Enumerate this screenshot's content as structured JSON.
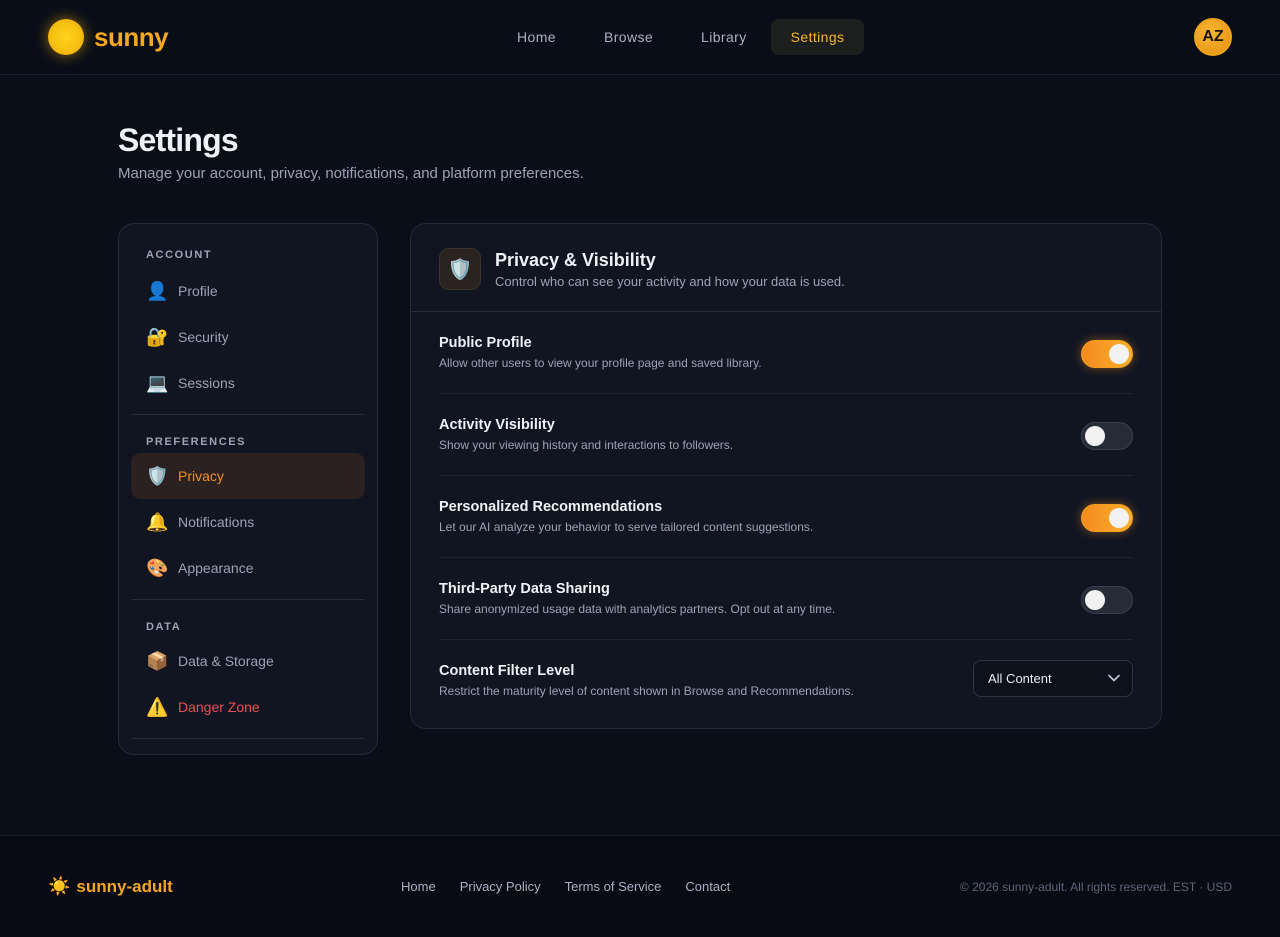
{
  "brand": {
    "name": "sunny"
  },
  "nav": {
    "items": [
      {
        "label": "Home"
      },
      {
        "label": "Browse"
      },
      {
        "label": "Library"
      },
      {
        "label": "Settings"
      }
    ],
    "active": "Settings"
  },
  "user": {
    "initials": "AZ"
  },
  "page": {
    "title": "Settings",
    "subtitle": "Manage your account, privacy, notifications, and platform preferences."
  },
  "sidebar": {
    "groups": [
      {
        "label": "ACCOUNT",
        "items": [
          {
            "label": "Profile",
            "icon": "👤",
            "icon_name": "user-icon"
          },
          {
            "label": "Security",
            "icon": "🔐",
            "icon_name": "lock-icon"
          },
          {
            "label": "Sessions",
            "icon": "💻",
            "icon_name": "laptop-icon"
          }
        ]
      },
      {
        "label": "PREFERENCES",
        "items": [
          {
            "label": "Privacy",
            "icon": "🛡️",
            "icon_name": "shield-icon",
            "active": true
          },
          {
            "label": "Notifications",
            "icon": "🔔",
            "icon_name": "bell-icon"
          },
          {
            "label": "Appearance",
            "icon": "🎨",
            "icon_name": "palette-icon"
          }
        ]
      },
      {
        "label": "DATA",
        "items": [
          {
            "label": "Data & Storage",
            "icon": "📦",
            "icon_name": "package-icon"
          },
          {
            "label": "Danger Zone",
            "icon": "⚠️",
            "icon_name": "warning-icon",
            "danger": true
          }
        ]
      }
    ]
  },
  "panel": {
    "icon": "🛡️",
    "title": "Privacy & Visibility",
    "description": "Control who can see your activity and how your data is used.",
    "settings": [
      {
        "title": "Public Profile",
        "description": "Allow other users to view your profile page and saved library.",
        "type": "toggle",
        "enabled": true
      },
      {
        "title": "Activity Visibility",
        "description": "Show your viewing history and interactions to followers.",
        "type": "toggle",
        "enabled": false
      },
      {
        "title": "Personalized Recommendations",
        "description": "Let our AI analyze your behavior to serve tailored content suggestions.",
        "type": "toggle",
        "enabled": true
      },
      {
        "title": "Third-Party Data Sharing",
        "description": "Share anonymized usage data with analytics partners. Opt out at any time.",
        "type": "toggle",
        "enabled": false
      },
      {
        "title": "Content Filter Level",
        "description": "Restrict the maturity level of content shown in Browse and Recommendations.",
        "type": "select",
        "value": "All Content"
      }
    ]
  },
  "footer": {
    "brand": "sunny-adult",
    "brand_icon": "☀️",
    "links": [
      "Home",
      "Privacy Policy",
      "Terms of Service",
      "Contact"
    ],
    "copyright": "© 2026 sunny-adult. All rights reserved. EST · USD"
  },
  "colors": {
    "accent": "#f5a623",
    "active_nav": "#f6b72b",
    "danger": "#ef4d4d",
    "background": "#0a0e19",
    "card": "#111522"
  }
}
